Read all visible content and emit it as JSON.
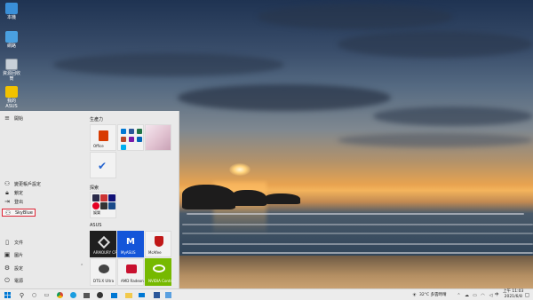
{
  "desktop": {
    "icons": [
      {
        "label": "本機",
        "icon": "this-pc-icon",
        "color": "#3a8fd8"
      },
      {
        "label": "網路",
        "icon": "network-icon",
        "color": "#4aa0e0"
      },
      {
        "label": "資源回收筒",
        "icon": "recycle-bin-icon",
        "color": "#c8d0d8"
      },
      {
        "label": "我的ASUS",
        "icon": "myasus-icon",
        "color": "#f2c200"
      }
    ]
  },
  "start_menu": {
    "header": {
      "label": "開始",
      "icon": "hamburger-icon"
    },
    "rail_items": [
      {
        "label": "變更帳戶設定",
        "icon": "person-icon"
      },
      {
        "label": "鎖定",
        "icon": "lock-icon"
      },
      {
        "label": "登出",
        "icon": "sign-out-icon"
      }
    ],
    "user": {
      "label": "SkyBlue",
      "icon": "user-icon"
    },
    "bottom_items": [
      {
        "label": "文件",
        "icon": "document-icon"
      },
      {
        "label": "圖片",
        "icon": "pictures-icon"
      },
      {
        "label": "設定",
        "icon": "gear-icon"
      },
      {
        "label": "電源",
        "icon": "power-icon"
      }
    ],
    "sections": {
      "productivity": "生產力",
      "explore": "探索",
      "asus": "ASUS"
    },
    "tiles": {
      "office": "Office",
      "play": "娛樂",
      "armoury": "ARMOURY CR...",
      "myasus": "MyASUS",
      "mcafee": "McAfee",
      "dts": "DTS:X Ultra",
      "amd": "AMD Radeon ...",
      "nvidia": "NVIDIA Contr..."
    }
  },
  "taskbar": {
    "weather": "32°C 多雲時晴",
    "ime": "中",
    "time": "上午 11:03",
    "date": "2021/6/8",
    "colors": {
      "accent": "#0078d4",
      "brand_mcafee": "#c01818",
      "brand_nvidia": "#76b900",
      "brand_office": "#d83b01"
    }
  }
}
